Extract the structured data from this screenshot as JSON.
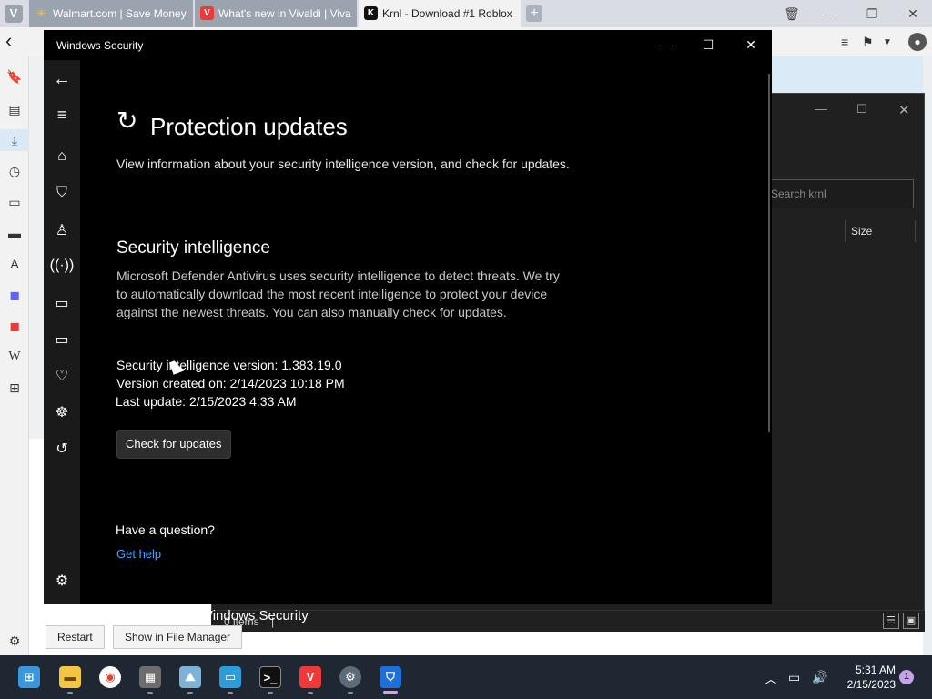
{
  "browser": {
    "tabs": [
      {
        "label": "Walmart.com | Save Money",
        "favicon": "walmart-icon"
      },
      {
        "label": "What's new in Vivaldi | Viva",
        "favicon": "vivaldi-icon"
      },
      {
        "label": "Krnl - Download #1 Roblox",
        "favicon": "krnl-icon"
      }
    ],
    "vivaldi_logo": "V",
    "new_tab": "+"
  },
  "downloads": {
    "restart_label": "Restart",
    "show_in_file_manager_label": "Show in File Manager"
  },
  "explorer": {
    "search_placeholder": "Search krnl",
    "column_size": "Size",
    "status": "0 items"
  },
  "security_window": {
    "title": "Windows Security",
    "page_title": "Protection updates",
    "subtitle": "View information about your security intelligence version, and check for updates.",
    "section_title": "Security intelligence",
    "description": "Microsoft Defender Antivirus uses security intelligence to detect threats. We try to automatically download the most recent intelligence to protect your device against the newest threats. You can also manually check for updates.",
    "version_line": "Security intelligence version: 1.383.19.0",
    "created_line": "Version created on: 2/14/2023 10:18 PM",
    "last_update_line": "Last update: 2/15/2023 4:33 AM",
    "check_button": "Check for updates",
    "question": "Have a question?",
    "help_link": "Get help",
    "improve_title": "Help improve Windows Security"
  },
  "taskbar": {
    "time": "5:31 AM",
    "date": "2/15/2023",
    "notification_count": "1"
  },
  "colors": {
    "accent": "#4aa3ff",
    "taskbar": "#1f2733",
    "window_bg": "#000000"
  }
}
